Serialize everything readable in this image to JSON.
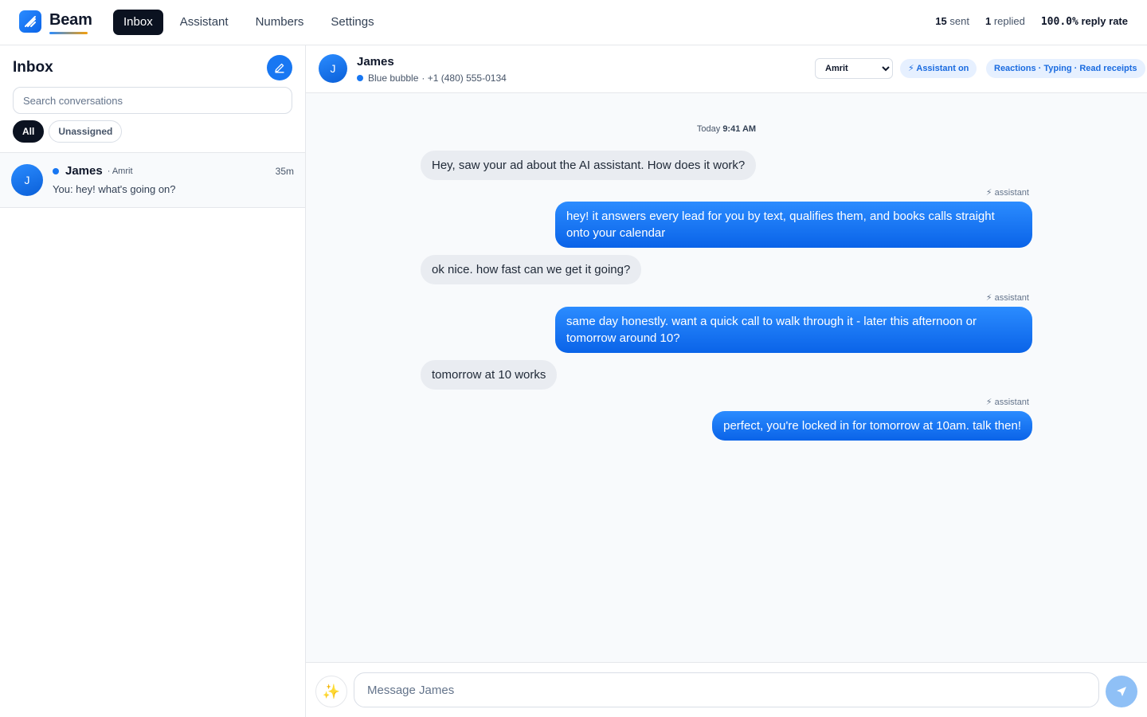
{
  "brand": {
    "name": "Beam"
  },
  "nav": {
    "items": [
      "Inbox",
      "Assistant",
      "Numbers",
      "Settings"
    ]
  },
  "stats": {
    "sent_count": "15",
    "sent_label": "sent",
    "replied_count": "1",
    "replied_label": "replied",
    "rate_value": "100.0%",
    "rate_label": "reply rate"
  },
  "sidebar": {
    "title": "Inbox",
    "search_placeholder": "Search conversations",
    "filters": [
      "All",
      "Unassigned"
    ],
    "conversations": [
      {
        "initial": "J",
        "name": "James",
        "assignee": "· Amrit",
        "time": "35m",
        "preview": "You: hey! what's going on?"
      }
    ]
  },
  "chat": {
    "initial": "J",
    "name": "James",
    "channel": "Blue bubble",
    "phone": "· +1 (480) 555-0134",
    "assignee": "Amrit",
    "assistant_pill": "⚡ Assistant on",
    "features_pill": "Reactions · Typing · Read receipts",
    "stamp_day": "Today",
    "stamp_time": "9:41 AM",
    "assistant_tag": "⚡ assistant",
    "messages": [
      {
        "dir": "in",
        "text": "Hey, saw your ad about the AI assistant. How does it work?"
      },
      {
        "dir": "out",
        "text": "hey! it answers every lead for you by text, qualifies them, and books calls straight onto your calendar"
      },
      {
        "dir": "in",
        "text": "ok nice. how fast can we get it going?"
      },
      {
        "dir": "out",
        "text": "same day honestly. want a quick call to walk through it - later this afternoon or tomorrow around 10?"
      },
      {
        "dir": "in",
        "text": "tomorrow at 10 works"
      },
      {
        "dir": "out",
        "text": "perfect, you're locked in for tomorrow at 10am. talk then!"
      }
    ],
    "composer_placeholder": "Message James",
    "ai_icon": "sparkles-icon"
  },
  "colors": {
    "accent": "#1877f2",
    "dark": "#0b1220"
  }
}
